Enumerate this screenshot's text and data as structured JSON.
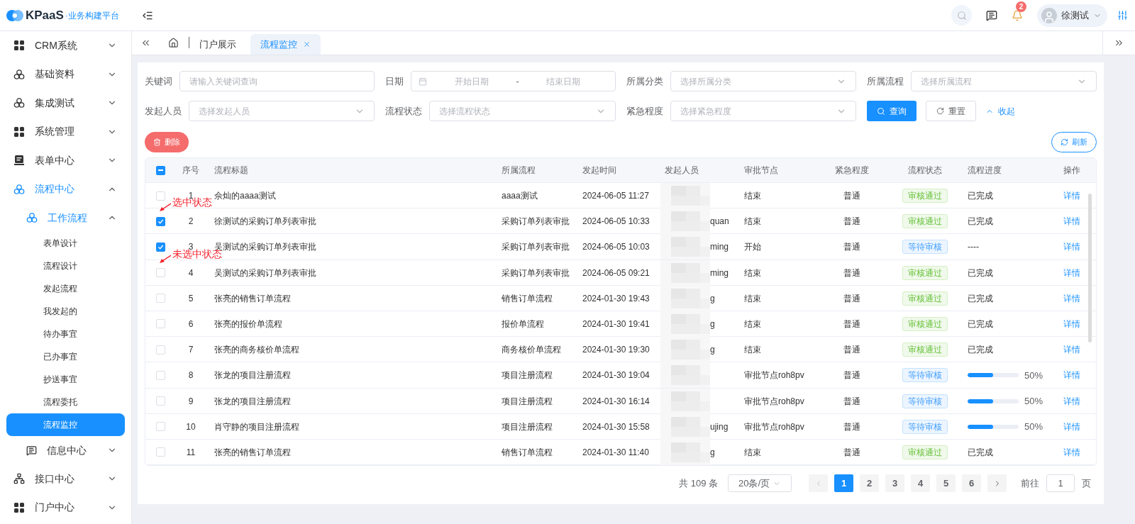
{
  "header": {
    "logo": "KPaaS",
    "subtitle": "·业务构建平台",
    "notification_count": "2",
    "user": "徐测试"
  },
  "sidebar": {
    "items": [
      {
        "label": "CRM系统",
        "kind": "grid",
        "expanded": false,
        "selected": false
      },
      {
        "label": "基础资料",
        "kind": "cluster",
        "expanded": false,
        "selected": false
      },
      {
        "label": "集成测试",
        "kind": "cluster",
        "expanded": false,
        "selected": false
      },
      {
        "label": "系统管理",
        "kind": "grid",
        "expanded": false,
        "selected": false
      },
      {
        "label": "表单中心",
        "kind": "form",
        "expanded": false,
        "selected": false
      },
      {
        "label": "流程中心",
        "kind": "flow",
        "expanded": true,
        "selected": true,
        "children": [
          {
            "label": "工作流程",
            "kind": "flow",
            "expanded": true,
            "selected": true,
            "children": [
              {
                "label": "表单设计",
                "selected": false
              },
              {
                "label": "流程设计",
                "selected": false
              },
              {
                "label": "发起流程",
                "selected": false
              },
              {
                "label": "我发起的",
                "selected": false
              },
              {
                "label": "待办事宜",
                "selected": false
              },
              {
                "label": "已办事宜",
                "selected": false
              },
              {
                "label": "抄送事宜",
                "selected": false
              },
              {
                "label": "流程委托",
                "selected": false
              },
              {
                "label": "流程监控",
                "selected": true
              }
            ]
          },
          {
            "label": "信息中心",
            "kind": "message",
            "expanded": false,
            "selected": false
          }
        ]
      },
      {
        "label": "接口中心",
        "kind": "org",
        "expanded": false,
        "selected": false
      },
      {
        "label": "门户中心",
        "kind": "grid",
        "expanded": false,
        "selected": false
      }
    ]
  },
  "tabs": [
    {
      "label": "门户展示",
      "selected": false,
      "closable": false
    },
    {
      "label": "流程监控",
      "selected": true,
      "closable": true
    }
  ],
  "filters": [
    {
      "label": "关键词",
      "kind": "text",
      "placeholder": "请输入关键词查询"
    },
    {
      "label": "日期",
      "kind": "date",
      "start_placeholder": "开始日期",
      "separator": "-",
      "end_placeholder": "结束日期"
    },
    {
      "label": "所属分类",
      "kind": "select",
      "placeholder": "选择所属分类"
    },
    {
      "label": "所属流程",
      "kind": "select",
      "placeholder": "选择所属流程"
    },
    {
      "label": "发起人员",
      "kind": "select",
      "placeholder": "选择发起人员"
    },
    {
      "label": "流程状态",
      "kind": "select",
      "placeholder": "选择流程状态"
    },
    {
      "label": "紧急程度",
      "kind": "select",
      "placeholder": "选择紧急程度"
    }
  ],
  "search_button": "查询",
  "reset_button": "重置",
  "collapse_link": "收起",
  "delete_button": "删除",
  "refresh_button": "刷新",
  "table": {
    "select_all_indeterminate": true,
    "columns": [
      "序号",
      "流程标题",
      "所属流程",
      "发起时间",
      "发起人员",
      "审批节点",
      "紧急程度",
      "流程状态",
      "流程进度",
      "操作"
    ],
    "rows": [
      {
        "selected": false,
        "no": "1",
        "title": "佘灿的aaaa测试",
        "flow": "aaaa测试",
        "time": "2024-06-05 11:27",
        "node": "结束",
        "urgency": "普通",
        "status": {
          "kind": "approved",
          "label": "审核通过"
        },
        "progress": {
          "kind": "text",
          "text": "已完成"
        },
        "action": "详情"
      },
      {
        "selected": true,
        "no": "2",
        "title": "徐测试的采购订单列表审批",
        "flow": "采购订单列表审批",
        "time": "2024-06-05 10:33",
        "initiator": "quan",
        "node": "结束",
        "urgency": "普通",
        "status": {
          "kind": "approved",
          "label": "审核通过"
        },
        "progress": {
          "kind": "text",
          "text": "已完成"
        },
        "action": "详情",
        "annotation": "选中状态"
      },
      {
        "selected": true,
        "no": "3",
        "title": "吴测试的采购订单列表审批",
        "flow": "采购订单列表审批",
        "time": "2024-06-05 10:03",
        "initiator": "ming",
        "node": "开始",
        "urgency": "普通",
        "status": {
          "kind": "pending",
          "label": "等待审核"
        },
        "progress": {
          "kind": "text",
          "text": "----"
        },
        "action": "详情"
      },
      {
        "selected": false,
        "no": "4",
        "title": "吴测试的采购订单列表审批",
        "flow": "采购订单列表审批",
        "time": "2024-06-05 09:21",
        "initiator": "ming",
        "node": "结束",
        "urgency": "普通",
        "status": {
          "kind": "approved",
          "label": "审核通过"
        },
        "progress": {
          "kind": "text",
          "text": "已完成"
        },
        "action": "详情",
        "annotation": "未选中状态"
      },
      {
        "selected": false,
        "no": "5",
        "title": "张亮的销售订单流程",
        "flow": "销售订单流程",
        "time": "2024-01-30 19:43",
        "initiator": "g",
        "node": "结束",
        "urgency": "普通",
        "status": {
          "kind": "approved",
          "label": "审核通过"
        },
        "progress": {
          "kind": "text",
          "text": "已完成"
        },
        "action": "详情"
      },
      {
        "selected": false,
        "no": "6",
        "title": "张亮的报价单流程",
        "flow": "报价单流程",
        "time": "2024-01-30 19:41",
        "initiator": "g",
        "node": "结束",
        "urgency": "普通",
        "status": {
          "kind": "approved",
          "label": "审核通过"
        },
        "progress": {
          "kind": "text",
          "text": "已完成"
        },
        "action": "详情"
      },
      {
        "selected": false,
        "no": "7",
        "title": "张亮的商务核价单流程",
        "flow": "商务核价单流程",
        "time": "2024-01-30 19:30",
        "initiator": "g",
        "node": "结束",
        "urgency": "普通",
        "status": {
          "kind": "approved",
          "label": "审核通过"
        },
        "progress": {
          "kind": "text",
          "text": "已完成"
        },
        "action": "详情"
      },
      {
        "selected": false,
        "no": "8",
        "title": "张龙的项目注册流程",
        "flow": "项目注册流程",
        "time": "2024-01-30 19:04",
        "node": "审批节点roh8pv",
        "urgency": "普通",
        "status": {
          "kind": "pending",
          "label": "等待审核"
        },
        "progress": {
          "kind": "bar",
          "level": 0.5,
          "text": "50%"
        },
        "action": "详情"
      },
      {
        "selected": false,
        "no": "9",
        "title": "张龙的项目注册流程",
        "flow": "项目注册流程",
        "time": "2024-01-30 16:14",
        "node": "审批节点roh8pv",
        "urgency": "普通",
        "status": {
          "kind": "pending",
          "label": "等待审核"
        },
        "progress": {
          "kind": "bar",
          "level": 0.5,
          "text": "50%"
        },
        "action": "详情"
      },
      {
        "selected": false,
        "no": "10",
        "title": "肖守静的项目注册流程",
        "flow": "项目注册流程",
        "time": "2024-01-30 15:58",
        "initiator": "ujing",
        "node": "审批节点roh8pv",
        "urgency": "普通",
        "status": {
          "kind": "pending",
          "label": "等待审核"
        },
        "progress": {
          "kind": "bar",
          "level": 0.5,
          "text": "50%"
        },
        "action": "详情"
      },
      {
        "selected": false,
        "no": "11",
        "title": "张亮的销售订单流程",
        "flow": "销售订单流程",
        "time": "2024-01-30 11:40",
        "initiator": "g",
        "node": "结束",
        "urgency": "普通",
        "status": {
          "kind": "approved",
          "label": "审核通过"
        },
        "progress": {
          "kind": "text",
          "text": "已完成"
        },
        "action": "详情"
      }
    ]
  },
  "pagination": {
    "total": "共 109 条",
    "page_size": "20条/页",
    "pages": [
      {
        "label": "1",
        "selected": true
      },
      {
        "label": "2",
        "selected": false
      },
      {
        "label": "3",
        "selected": false
      },
      {
        "label": "4",
        "selected": false
      },
      {
        "label": "5",
        "selected": false
      },
      {
        "label": "6",
        "selected": false
      }
    ],
    "goto_label": "前往",
    "goto_value": "1",
    "goto_suffix": "页"
  }
}
